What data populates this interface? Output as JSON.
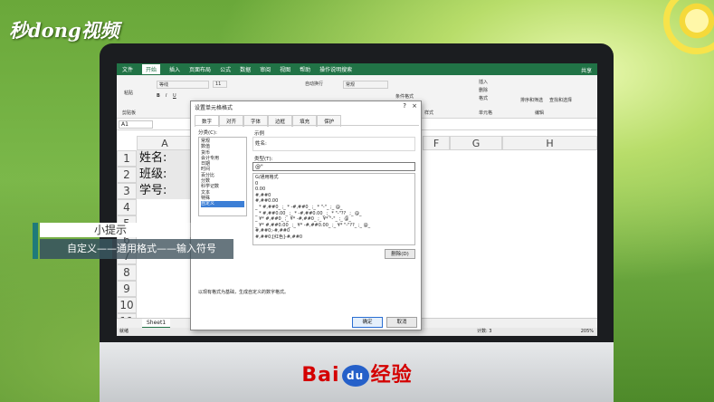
{
  "watermark": {
    "logo": "秒dong视频",
    "brand": "Bai",
    "brand_mid": "du",
    "brand_end": "经验"
  },
  "excel": {
    "menu": [
      "文件",
      "开始",
      "插入",
      "页面布局",
      "公式",
      "数据",
      "审阅",
      "视图",
      "帮助",
      "操作说明搜索"
    ],
    "active_menu": "开始",
    "share": "共享",
    "ribbon": {
      "clipboard": "剪贴板",
      "paste": "粘贴",
      "font": "等线",
      "size": "11",
      "wrap": "自动换行",
      "number_fmt": "常规",
      "cond_fmt": "条件格式",
      "insert": "插入",
      "delete": "删除",
      "format": "格式",
      "sort": "排序和筛选",
      "find": "查找和选择",
      "styles": "样式",
      "cells": "单元格",
      "edit": "编辑"
    },
    "namebox": "A1",
    "columns": [
      "A",
      "F",
      "G",
      "H"
    ],
    "rows": [
      "1",
      "2",
      "3",
      "4",
      "5",
      "6",
      "7",
      "8",
      "9",
      "10",
      "11"
    ],
    "cells": [
      "姓名:",
      "班级:",
      "学号:"
    ],
    "sheet": "Sheet1",
    "status": "就绪",
    "count": "计数: 3",
    "zoom": "205%"
  },
  "dialog": {
    "title": "设置单元格格式",
    "help": "?",
    "close": "×",
    "tabs": [
      "数字",
      "对齐",
      "字体",
      "边框",
      "填充",
      "保护"
    ],
    "category_label": "分类(C):",
    "categories": [
      "常规",
      "数值",
      "货币",
      "会计专用",
      "日期",
      "时间",
      "百分比",
      "分数",
      "科学记数",
      "文本",
      "特殊",
      "自定义"
    ],
    "selected_category": "自定义",
    "sample_label": "示例",
    "sample_value": "姓名:",
    "type_label": "类型(T):",
    "type_value": "@\"",
    "formats": [
      "G/通用格式",
      "0",
      "0.00",
      "#,##0",
      "#,##0.00",
      "_ * #,##0_ ;_ * -#,##0_ ;_ * \"-\"_ ;_ @_",
      "_ * #,##0.00_ ;_ * -#,##0.00_ ;_ * \"-\"??_ ;_ @_",
      "_ ¥* #,##0_ ;_ ¥* -#,##0_ ;_ ¥* \"-\"_ ;_ @_",
      "_ ¥* #,##0.00_ ;_ ¥* -#,##0.00_ ;_ ¥* \"-\"??_ ;_ @_",
      "#,##0;-#,##0",
      "#,##0;[红色]-#,##0"
    ],
    "delete": "删除(D)",
    "note": "以现有格式为基础，生成自定义的数字格式。",
    "ok": "确定",
    "cancel": "取消"
  },
  "tip": {
    "title": "小提示",
    "body": "自定义——通用格式——输入符号"
  }
}
